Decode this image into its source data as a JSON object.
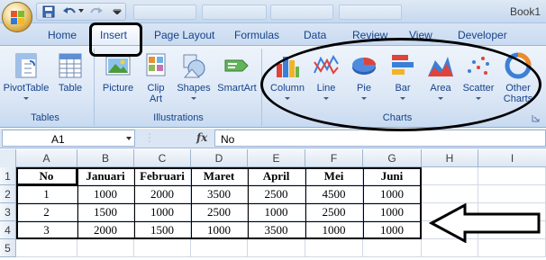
{
  "window": {
    "title": "Book1"
  },
  "tabs": [
    "Home",
    "Insert",
    "Page Layout",
    "Formulas",
    "Data",
    "Review",
    "View",
    "Developer"
  ],
  "ribbon": {
    "groups": [
      {
        "label": "Tables",
        "buttons": [
          "PivotTable",
          "Table"
        ]
      },
      {
        "label": "Illustrations",
        "buttons": [
          "Picture",
          "Clip Art",
          "Shapes",
          "SmartArt"
        ]
      },
      {
        "label": "Charts",
        "buttons": [
          "Column",
          "Line",
          "Pie",
          "Bar",
          "Area",
          "Scatter",
          "Other Charts"
        ]
      }
    ]
  },
  "formula_bar": {
    "name_box": "A1",
    "fx": "fx",
    "value": "No"
  },
  "columns": [
    "A",
    "B",
    "C",
    "D",
    "E",
    "F",
    "G",
    "H",
    "I"
  ],
  "rows": [
    "1",
    "2",
    "3",
    "4",
    "5"
  ],
  "sheet": {
    "header": [
      "No",
      "Januari",
      "Februari",
      "Maret",
      "April",
      "Mei",
      "Juni"
    ],
    "data": [
      [
        "1",
        "1000",
        "2000",
        "3500",
        "2500",
        "4500",
        "1000"
      ],
      [
        "2",
        "1500",
        "1000",
        "2500",
        "1000",
        "2500",
        "1000"
      ],
      [
        "3",
        "2000",
        "1500",
        "1000",
        "3500",
        "1000",
        "1000"
      ]
    ]
  },
  "colors": {
    "ribbon_text": "#15428b",
    "annotation": "#000000"
  }
}
